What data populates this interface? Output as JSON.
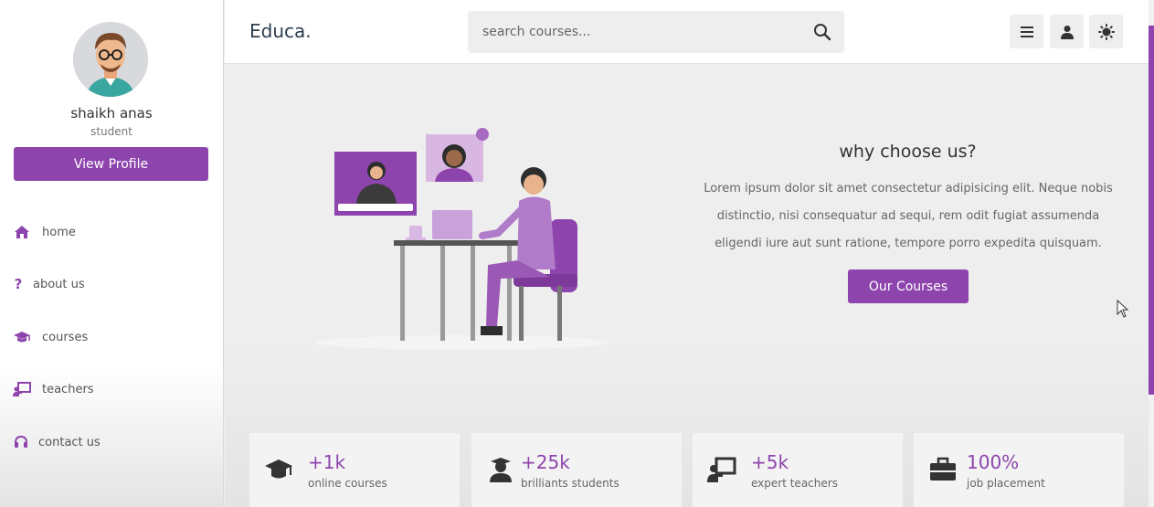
{
  "profile": {
    "name": "shaikh anas",
    "role": "student",
    "button_label": "View Profile"
  },
  "nav": [
    {
      "label": "home",
      "icon": "home-icon"
    },
    {
      "label": "about us",
      "icon": "question-icon"
    },
    {
      "label": "courses",
      "icon": "graduation-cap-icon"
    },
    {
      "label": "teachers",
      "icon": "chalkboard-teacher-icon"
    },
    {
      "label": "contact us",
      "icon": "headset-icon"
    }
  ],
  "header": {
    "logo": "Educa.",
    "search_placeholder": "search courses...",
    "buttons": [
      "menu-icon",
      "user-icon",
      "sun-icon"
    ]
  },
  "hero": {
    "title": "why choose us?",
    "text": "Lorem ipsum dolor sit amet consectetur adipisicing elit. Neque nobis distinctio, nisi consequatur ad sequi, rem odit fugiat assumenda eligendi iure aut sunt ratione, tempore porro expedita quisquam.",
    "button_label": "Our Courses"
  },
  "stats": [
    {
      "value": "+1k",
      "label": "online courses",
      "icon": "graduation-cap-icon"
    },
    {
      "value": "+25k",
      "label": "brilliants students",
      "icon": "user-graduate-icon"
    },
    {
      "value": "+5k",
      "label": "expert teachers",
      "icon": "chalkboard-teacher-icon"
    },
    {
      "value": "100%",
      "label": "job placement",
      "icon": "briefcase-icon"
    }
  ],
  "colors": {
    "accent": "#8e44ad",
    "background": "#eeeeee",
    "text": "#333333"
  }
}
